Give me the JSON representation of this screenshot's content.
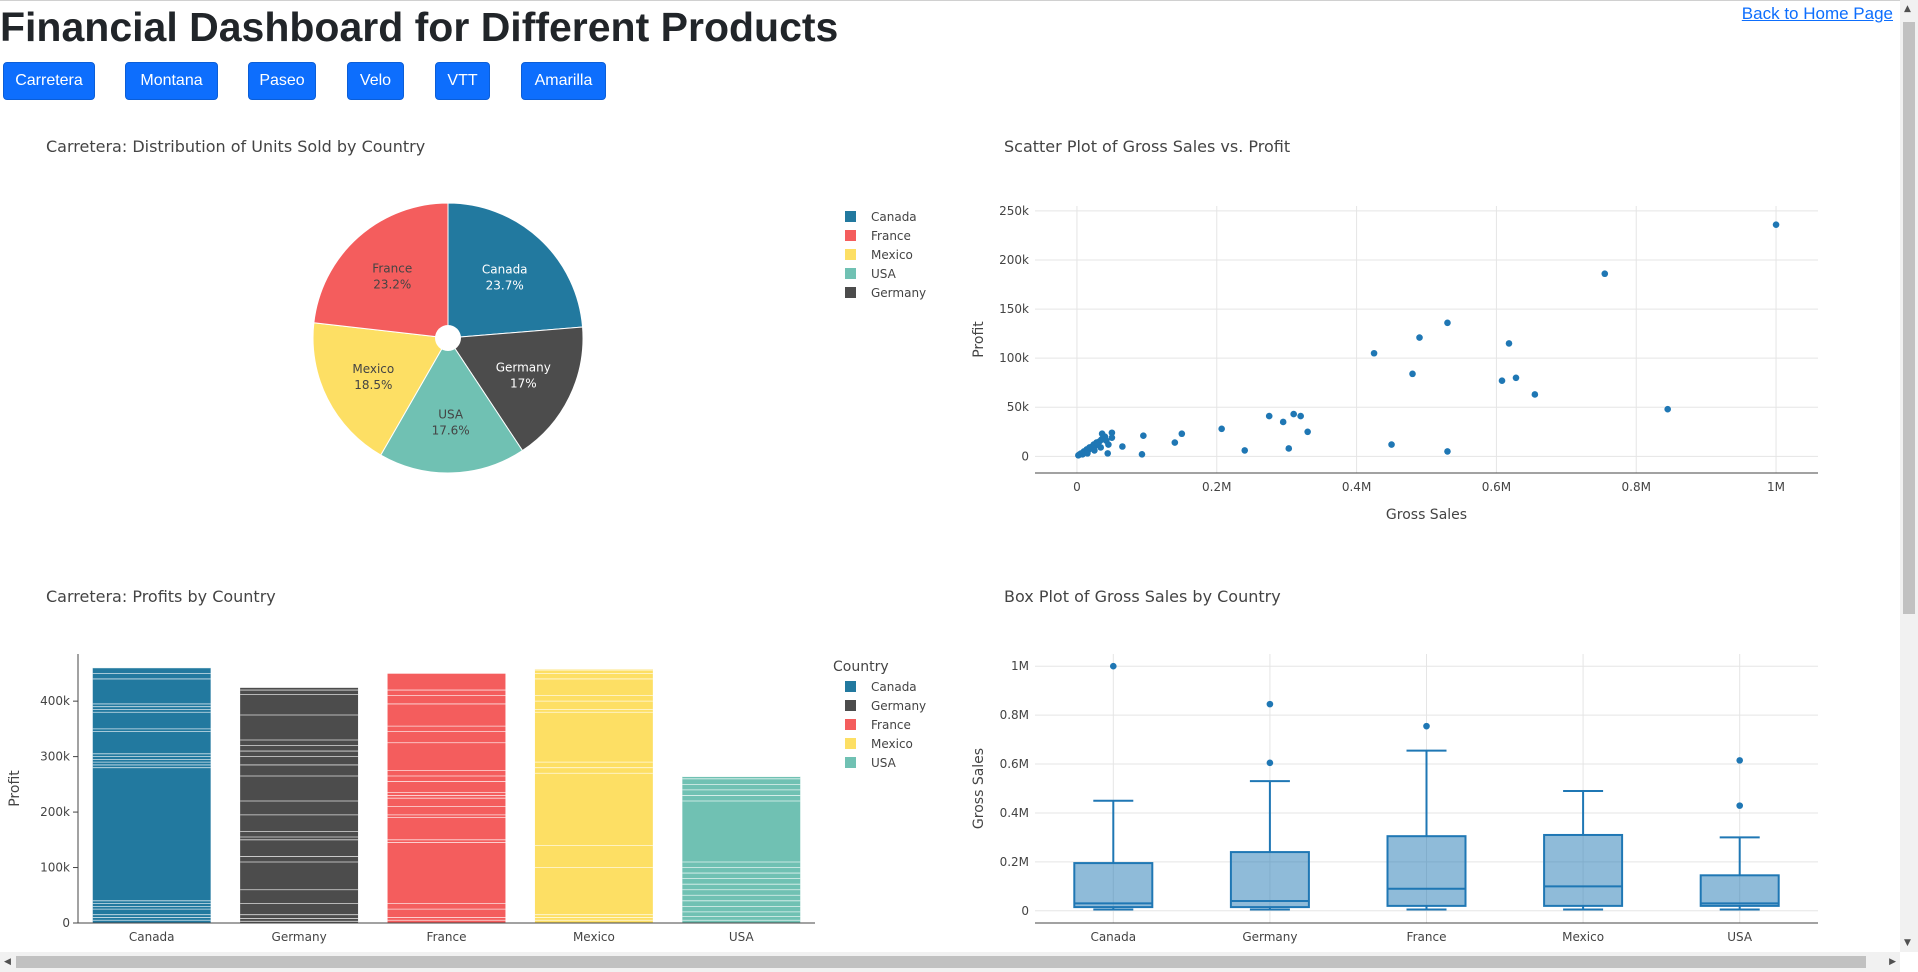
{
  "header": {
    "title": "Financial Dashboard for Different Products",
    "home_link": "Back to Home Page"
  },
  "products": [
    "Carretera",
    "Montana",
    "Paseo",
    "Velo",
    "VTT",
    "Amarilla"
  ],
  "colors": {
    "Canada": "#22799f",
    "France": "#f45d5d",
    "Mexico": "#fddf64",
    "USA": "#70c1b3",
    "Germany": "#4c4c4c",
    "accent": "#0d6efd",
    "scatter": "#1f77b4"
  },
  "chart_data": [
    {
      "type": "pie",
      "title": "Carretera: Distribution of Units Sold by Country",
      "slices": [
        {
          "label": "Canada",
          "value": 23.7
        },
        {
          "label": "Germany",
          "value": 17
        },
        {
          "label": "USA",
          "value": 17.6
        },
        {
          "label": "Mexico",
          "value": 18.5
        },
        {
          "label": "France",
          "value": 23.2
        }
      ],
      "legend": [
        "Canada",
        "France",
        "Mexico",
        "USA",
        "Germany"
      ],
      "legend_position": "right"
    },
    {
      "type": "scatter",
      "title": "Scatter Plot of Gross Sales vs. Profit",
      "xlabel": "Gross Sales",
      "ylabel": "Profit",
      "xlim": [
        -0.06,
        1.06
      ],
      "ylim": [
        -17,
        255
      ],
      "x_ticks": [
        "0",
        "0.2M",
        "0.4M",
        "0.6M",
        "0.8M",
        "1M"
      ],
      "y_ticks": [
        "0",
        "50k",
        "100k",
        "150k",
        "200k",
        "250k"
      ],
      "x_tick_values": [
        0,
        0.2,
        0.4,
        0.6,
        0.8,
        1
      ],
      "y_tick_values": [
        0,
        50,
        100,
        150,
        200,
        250
      ],
      "points": [
        [
          0.002,
          1
        ],
        [
          0.004,
          2
        ],
        [
          0.006,
          3
        ],
        [
          0.008,
          2
        ],
        [
          0.01,
          5
        ],
        [
          0.012,
          4
        ],
        [
          0.014,
          7
        ],
        [
          0.016,
          6
        ],
        [
          0.018,
          9
        ],
        [
          0.02,
          8
        ],
        [
          0.022,
          10
        ],
        [
          0.024,
          12
        ],
        [
          0.026,
          11
        ],
        [
          0.028,
          14
        ],
        [
          0.03,
          13
        ],
        [
          0.032,
          15
        ],
        [
          0.035,
          17
        ],
        [
          0.038,
          18
        ],
        [
          0.04,
          20
        ],
        [
          0.042,
          16
        ],
        [
          0.015,
          3
        ],
        [
          0.025,
          6
        ],
        [
          0.034,
          9
        ],
        [
          0.045,
          12
        ],
        [
          0.036,
          23
        ],
        [
          0.05,
          24
        ],
        [
          0.05,
          19
        ],
        [
          0.044,
          3
        ],
        [
          0.065,
          10
        ],
        [
          0.095,
          21
        ],
        [
          0.093,
          2
        ],
        [
          0.14,
          14
        ],
        [
          0.15,
          23
        ],
        [
          0.207,
          28
        ],
        [
          0.24,
          6
        ],
        [
          0.275,
          41
        ],
        [
          0.295,
          35
        ],
        [
          0.303,
          8
        ],
        [
          0.31,
          43
        ],
        [
          0.32,
          41
        ],
        [
          0.33,
          25
        ],
        [
          0.425,
          105
        ],
        [
          0.45,
          12
        ],
        [
          0.48,
          84
        ],
        [
          0.49,
          121
        ],
        [
          0.53,
          136
        ],
        [
          0.53,
          5
        ],
        [
          0.608,
          77
        ],
        [
          0.618,
          115
        ],
        [
          0.628,
          80
        ],
        [
          0.655,
          63
        ],
        [
          0.755,
          186
        ],
        [
          0.845,
          48
        ],
        [
          1.0,
          236
        ]
      ]
    },
    {
      "type": "bar",
      "title": "Carretera: Profits by Country",
      "ylabel": "Profit",
      "xlabel": "",
      "categories": [
        "Canada",
        "Germany",
        "France",
        "Mexico",
        "USA"
      ],
      "values": [
        460,
        424,
        450,
        458,
        264
      ],
      "ylim": [
        0,
        485
      ],
      "y_ticks": [
        "0",
        "100k",
        "200k",
        "300k",
        "400k"
      ],
      "y_tick_values": [
        0,
        100,
        200,
        300,
        400
      ],
      "legend_title": "Country",
      "legend": [
        "Canada",
        "Germany",
        "France",
        "Mexico",
        "USA"
      ],
      "legend_position": "right",
      "segment_lines": {
        "Canada": [
          5,
          10,
          15,
          25,
          30,
          35,
          40,
          280,
          285,
          290,
          295,
          300,
          305,
          345,
          350,
          380,
          385,
          390,
          395,
          440,
          450,
          460
        ],
        "Germany": [
          3,
          8,
          15,
          35,
          60,
          110,
          120,
          150,
          155,
          165,
          195,
          220,
          265,
          285,
          300,
          310,
          320,
          330,
          375,
          412,
          420
        ],
        "France": [
          5,
          10,
          25,
          35,
          145,
          150,
          190,
          195,
          210,
          225,
          230,
          235,
          255,
          265,
          275,
          325,
          345,
          355,
          395,
          410,
          420,
          450
        ],
        "Mexico": [
          5,
          10,
          15,
          100,
          140,
          270,
          280,
          290,
          380,
          385,
          400,
          410,
          440,
          450,
          456,
          458
        ],
        "USA": [
          5,
          12,
          20,
          30,
          40,
          50,
          60,
          70,
          80,
          90,
          100,
          110,
          220,
          230,
          240,
          250,
          260,
          264
        ]
      }
    },
    {
      "type": "box",
      "title": "Box Plot of Gross Sales by Country",
      "ylabel": "Gross Sales",
      "xlabel": "",
      "categories": [
        "Canada",
        "Germany",
        "France",
        "Mexico",
        "USA"
      ],
      "ylim": [
        -0.05,
        1.05
      ],
      "y_ticks": [
        "0",
        "0.2M",
        "0.4M",
        "0.6M",
        "0.8M",
        "1M"
      ],
      "y_tick_values": [
        0,
        0.2,
        0.4,
        0.6,
        0.8,
        1
      ],
      "boxes": [
        {
          "min": 0.005,
          "q1": 0.015,
          "median": 0.03,
          "q3": 0.195,
          "max": 0.45,
          "outliers": [
            1.0
          ]
        },
        {
          "min": 0.005,
          "q1": 0.015,
          "median": 0.04,
          "q3": 0.24,
          "max": 0.53,
          "outliers": [
            0.845,
            0.605
          ]
        },
        {
          "min": 0.005,
          "q1": 0.02,
          "median": 0.09,
          "q3": 0.305,
          "max": 0.655,
          "outliers": [
            0.755
          ]
        },
        {
          "min": 0.005,
          "q1": 0.02,
          "median": 0.1,
          "q3": 0.31,
          "max": 0.49,
          "outliers": []
        },
        {
          "min": 0.005,
          "q1": 0.02,
          "median": 0.03,
          "q3": 0.145,
          "max": 0.3,
          "outliers": [
            0.615,
            0.43
          ]
        }
      ]
    }
  ]
}
